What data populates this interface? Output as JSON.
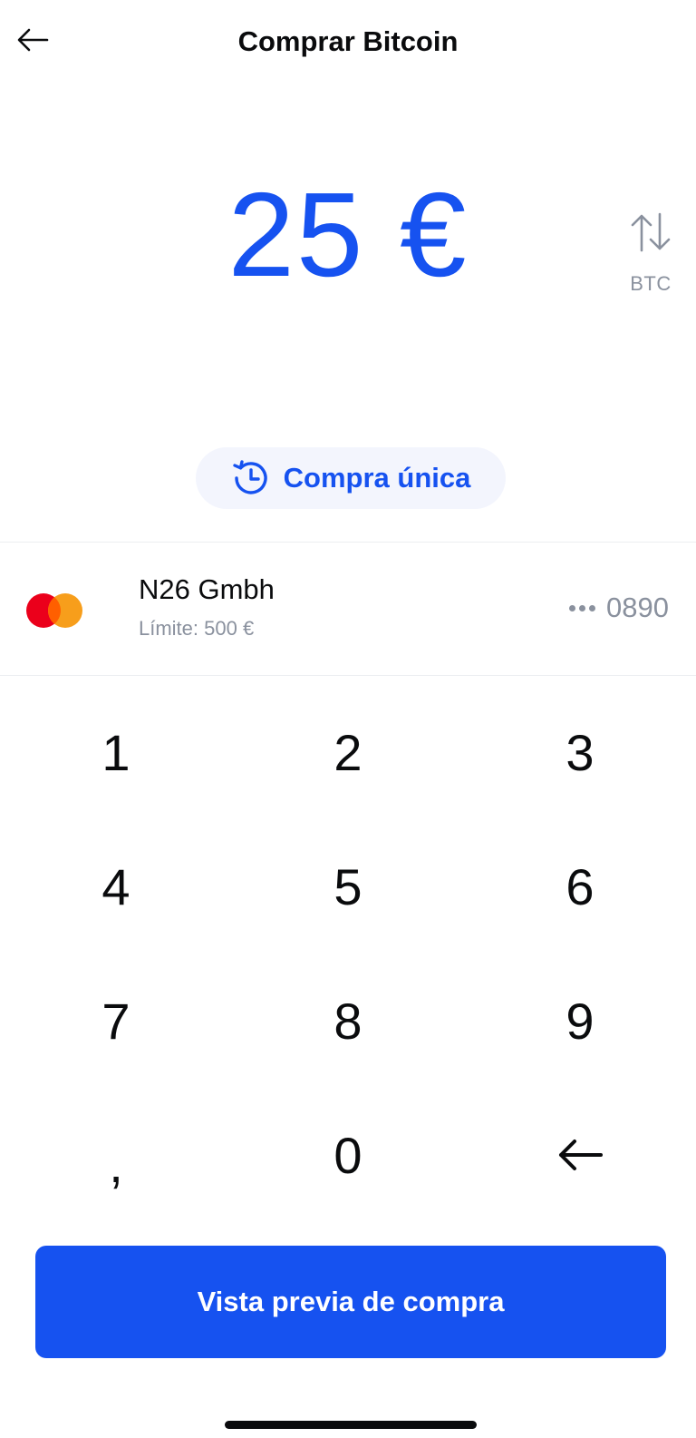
{
  "header": {
    "title": "Comprar Bitcoin"
  },
  "amount": {
    "display": "25 €"
  },
  "currency_toggle": {
    "label": "BTC"
  },
  "frequency": {
    "label": "Compra única"
  },
  "payment_method": {
    "name": "N26 Gmbh",
    "limit": "Límite: 500 €",
    "last4": "0890"
  },
  "keypad": {
    "keys": [
      "1",
      "2",
      "3",
      "4",
      "5",
      "6",
      "7",
      "8",
      "9",
      ",",
      "0"
    ],
    "backspace_icon": "arrow-left-icon"
  },
  "cta": {
    "label": "Vista previa de compra"
  },
  "colors": {
    "accent": "#1652f0",
    "muted": "#8a919e",
    "pill_bg": "#f3f5fd",
    "mastercard_red": "#eb001b",
    "mastercard_orange": "#f79e1b"
  }
}
